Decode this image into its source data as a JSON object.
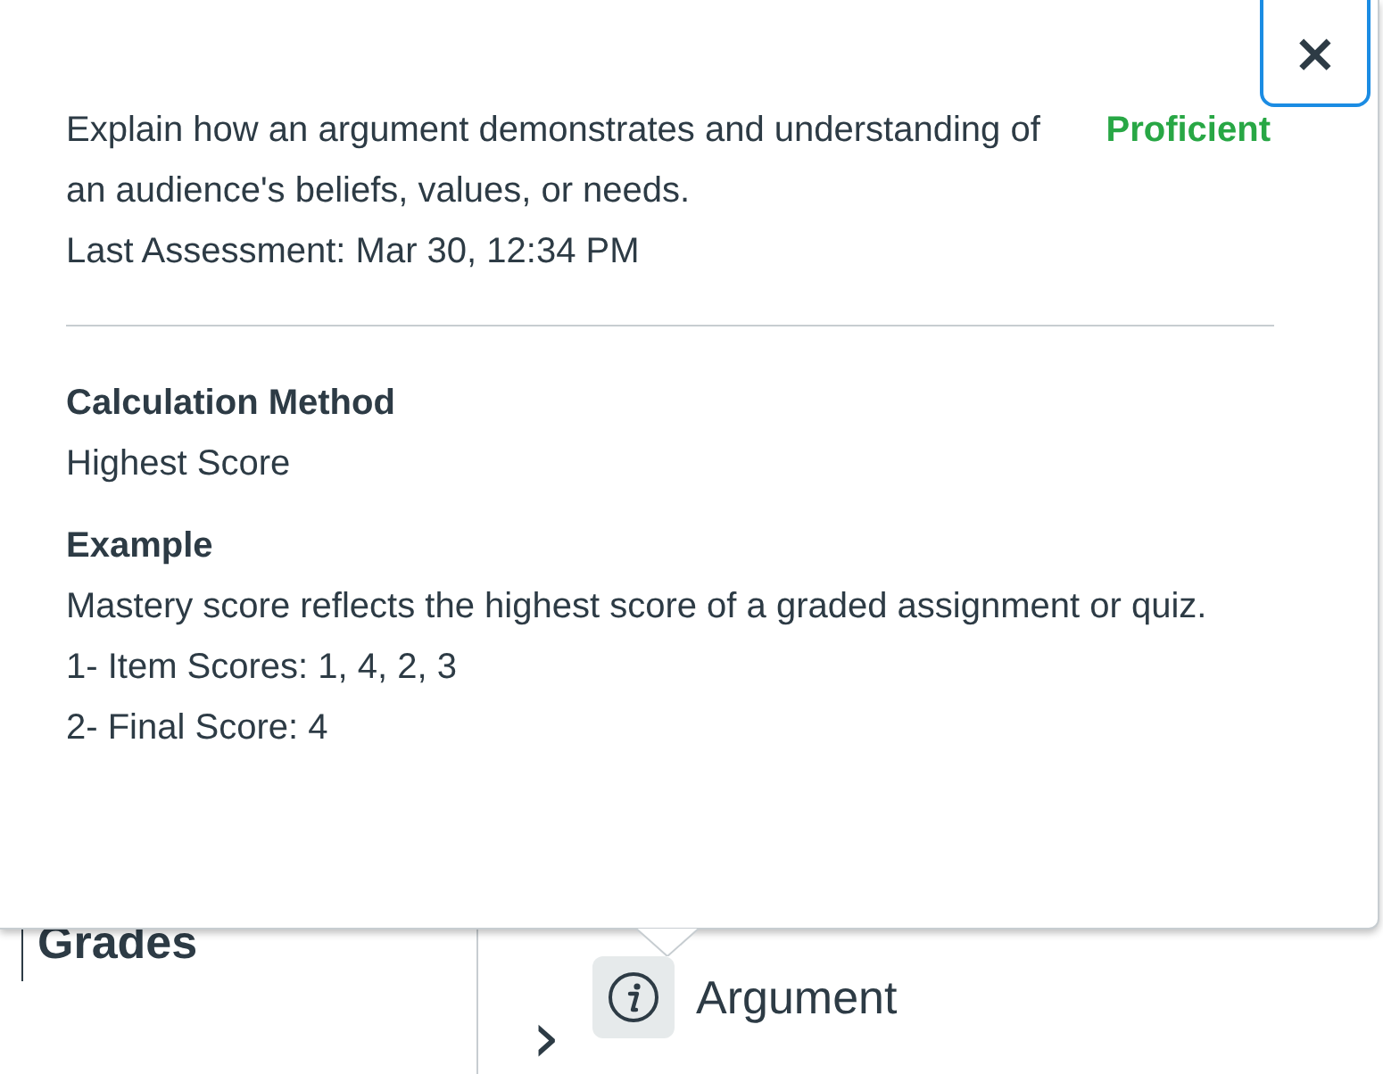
{
  "popover": {
    "close_label": "×",
    "outcome": "Explain how an argument demonstrates and understanding of an audience's beliefs, values, or needs.",
    "mastery": "Proficient",
    "last_assessment": "Last Assessment: Mar 30, 12:34 PM",
    "sections": [
      {
        "heading": "Calculation Method",
        "lines": [
          "Highest Score"
        ]
      },
      {
        "heading": "Example",
        "lines": [
          "Mastery score reflects the highest score of a graded assignment or quiz.",
          "1- Item Scores: 1, 4, 2, 3",
          "2- Final Score: 4"
        ]
      }
    ]
  },
  "page": {
    "heading": "Grades",
    "expand_label": "›",
    "outcome_title": "Argument"
  }
}
